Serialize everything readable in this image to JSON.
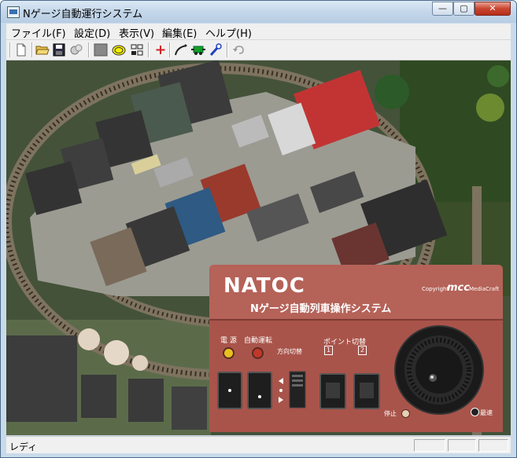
{
  "window": {
    "title": "Nゲージ自動運行システム"
  },
  "window_buttons": {
    "minimize": "—",
    "maximize": "▢",
    "close": "✕"
  },
  "menu": {
    "items": [
      {
        "label": "ファイル(F)"
      },
      {
        "label": "設定(D)"
      },
      {
        "label": "表示(V)"
      },
      {
        "label": "編集(E)"
      },
      {
        "label": "ヘルプ(H)"
      }
    ]
  },
  "toolbar": {
    "icons": [
      "new-file-icon",
      "open-folder-icon",
      "save-icon",
      "settings-icon",
      "gray-square-icon",
      "yellow-ellipse-icon",
      "grid-icon",
      "add-icon",
      "track-icon",
      "locomotive-icon",
      "tool-icon",
      "undo-icon"
    ]
  },
  "controller": {
    "brand": "NATOC",
    "subtitle": "Nゲージ自動列車操作システム",
    "copyright": "Copyright",
    "maker_logo": "mcc",
    "maker_name": "MediaCraft",
    "power_label": "電 源",
    "auto_label": "自動運転",
    "direction_label": "方向切替",
    "point_label": "ポイント切替",
    "point_1": "1",
    "point_2": "2",
    "stop_label": "停止",
    "max_speed_label": "最速",
    "colors": {
      "panel": "#a9544a",
      "panel_dark": "#7e3a33",
      "power_led": "#e8c020",
      "auto_led": "#d04020"
    }
  },
  "status": {
    "text": "レディ"
  }
}
